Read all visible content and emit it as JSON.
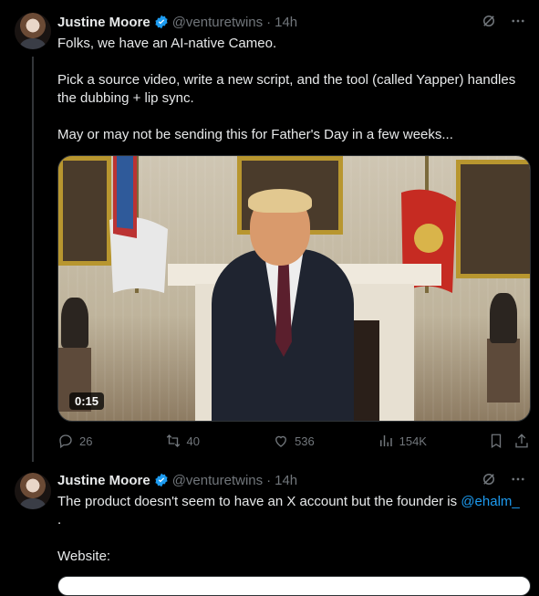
{
  "tweets": [
    {
      "author": "Justine Moore",
      "handle": "@venturetwins",
      "time": "14h",
      "text": "Folks, we have an AI-native Cameo.\n\nPick a source video, write a new script, and the tool (called Yapper) handles the dubbing + lip sync.\n\nMay or may not be sending this for Father's Day in a few weeks...",
      "media": {
        "duration": "0:15"
      },
      "actions": {
        "replies": "26",
        "reposts": "40",
        "likes": "536",
        "views": "154K"
      }
    },
    {
      "author": "Justine Moore",
      "handle": "@venturetwins",
      "time": "14h",
      "text_before_link": "The product doesn't seem to have an X account but the founder is ",
      "link_text": "@ehalm_",
      "text_after_link": "\n.\n\nWebsite:"
    }
  ],
  "icons": {
    "verified": "verified-badge-icon",
    "grok": "grok-icon",
    "more": "more-icon",
    "reply": "reply-icon",
    "repost": "repost-icon",
    "like": "like-icon",
    "views": "views-icon",
    "bookmark": "bookmark-icon",
    "share": "share-icon"
  },
  "colors": {
    "background": "#000000",
    "text": "#e7e9ea",
    "muted": "#71767b",
    "link": "#1d9bf0"
  }
}
